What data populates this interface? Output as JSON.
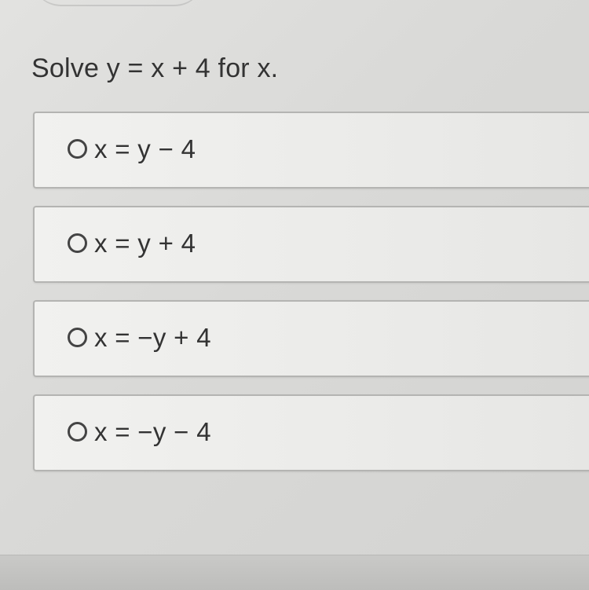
{
  "question": {
    "text": "Solve y = x + 4 for x."
  },
  "options": [
    {
      "label": "x = y − 4"
    },
    {
      "label": "x = y + 4"
    },
    {
      "label": "x = −y + 4"
    },
    {
      "label": "x = −y − 4"
    }
  ],
  "icons": {
    "radio": "radio-unselected-icon"
  }
}
